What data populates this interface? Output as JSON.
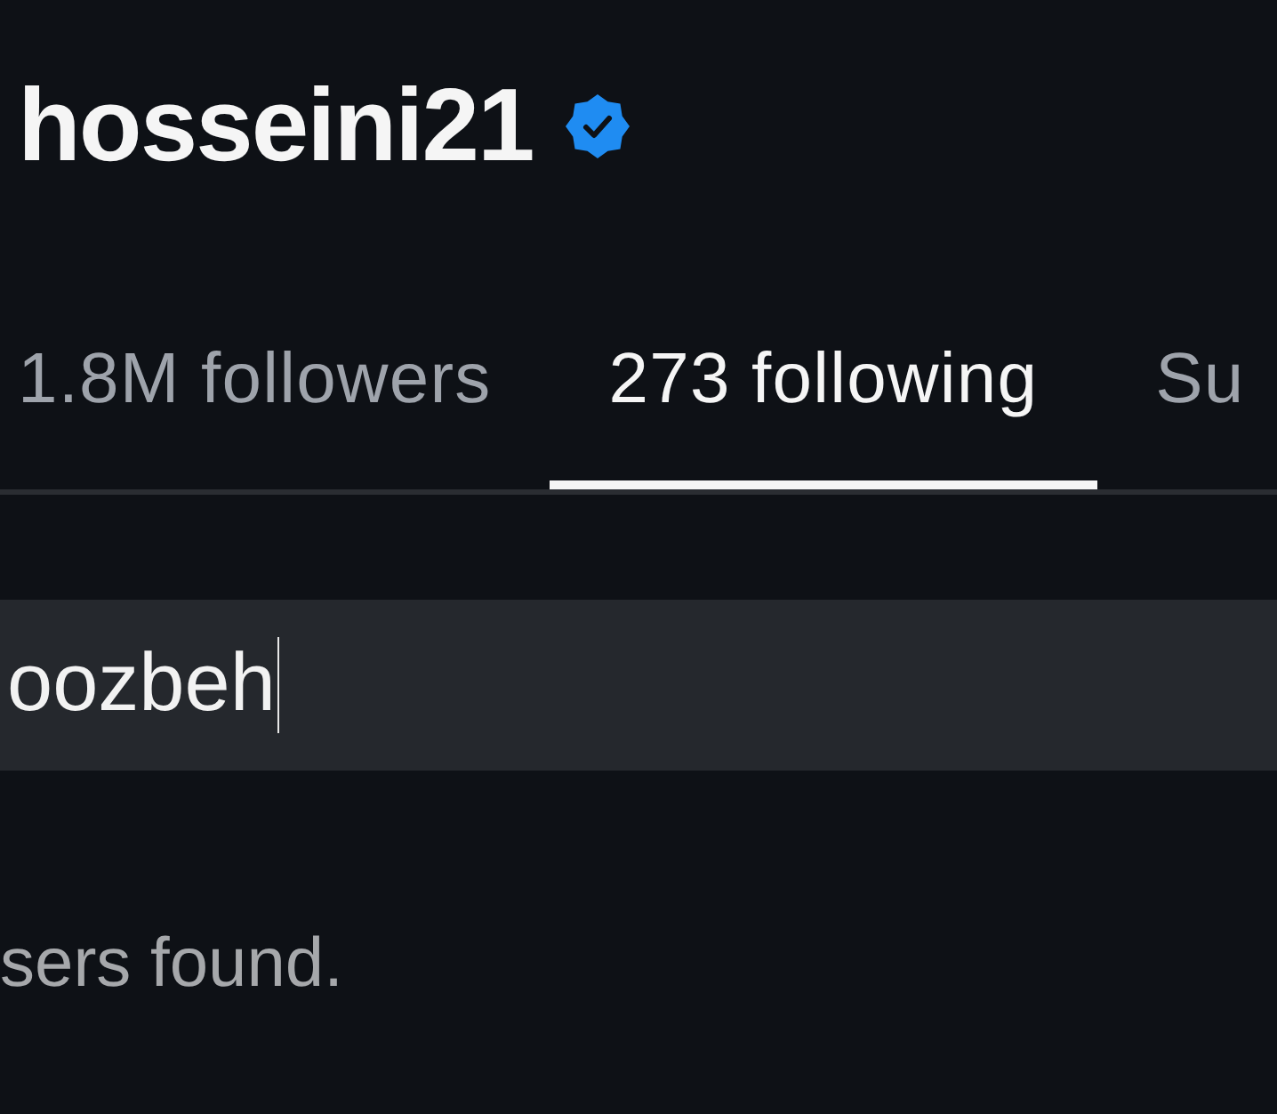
{
  "profile": {
    "username": "hosseini21",
    "verified": true
  },
  "tabs": [
    {
      "label": "1.8M followers",
      "selected": false
    },
    {
      "label": "273 following",
      "selected": true
    },
    {
      "label": "Su",
      "selected": false
    }
  ],
  "search": {
    "value": "oozbeh",
    "focused": true
  },
  "empty_message": "sers found."
}
